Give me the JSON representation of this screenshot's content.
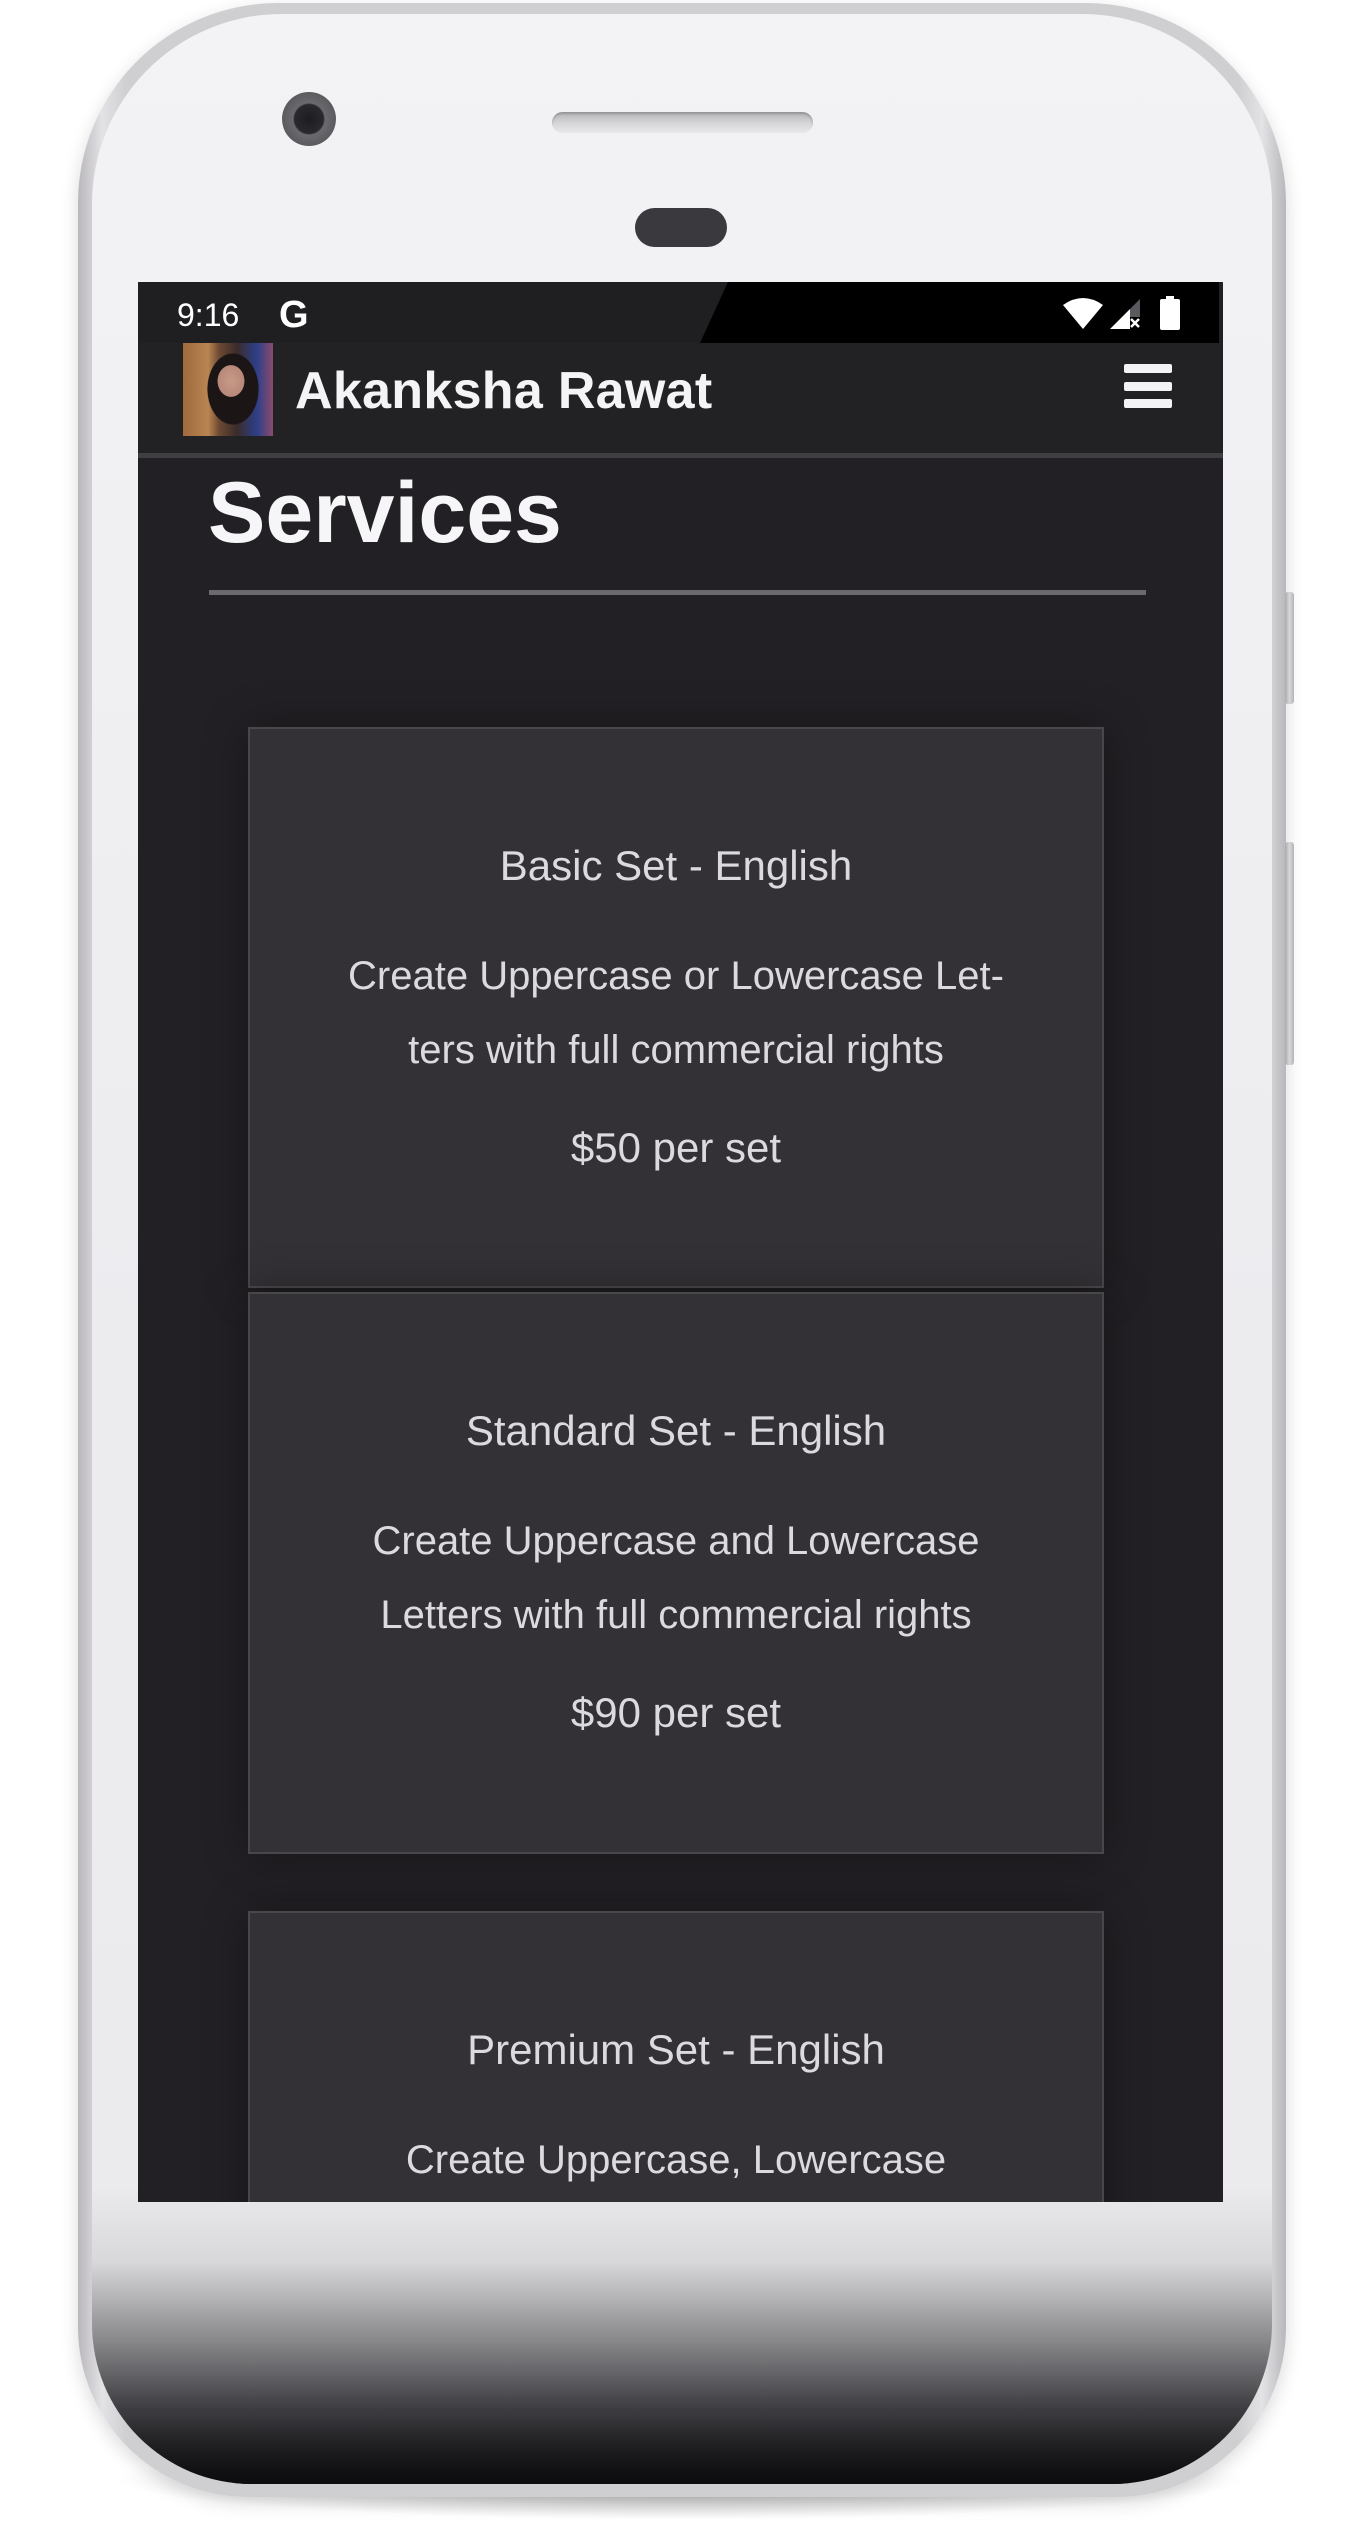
{
  "status_bar": {
    "time": "9:16",
    "notification_icon": "google-g-icon",
    "notification_glyph": "G",
    "icons": [
      "wifi-icon",
      "cellular-signal-no-data-icon",
      "battery-icon"
    ]
  },
  "navbar": {
    "avatar": "profile-photo",
    "site_name": "Akanksha Rawat",
    "menu_icon": "hamburger-menu-icon"
  },
  "page": {
    "title": "Services"
  },
  "services": [
    {
      "title": "Basic Set - English",
      "description": "Create Uppercase or Lowercase Let-ters with full commercial rights",
      "price": "$50 per set"
    },
    {
      "title": "Standard Set - English",
      "description": "Create Uppercase and Lowercase Letters with full commercial rights",
      "price": "$90 per set"
    },
    {
      "title": "Premium Set - English",
      "description": "Create Uppercase, Lowercase",
      "price": ""
    }
  ],
  "colors": {
    "screen_background": "#222024",
    "card_background": "#333135",
    "card_border": "#48474a",
    "text_primary": "#f4f3f6",
    "text_card": "#dbdade",
    "divider": "#6a696d"
  }
}
